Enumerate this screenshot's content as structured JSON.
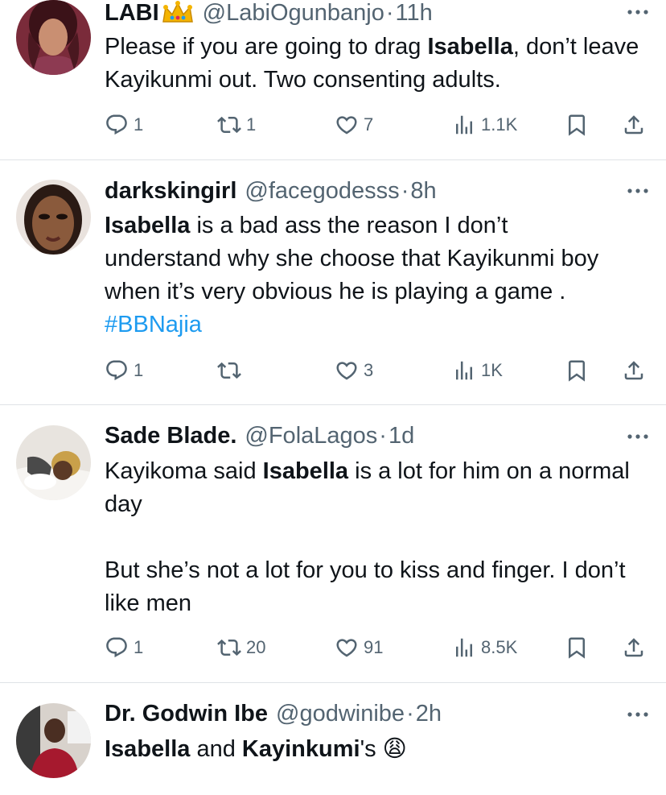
{
  "tweets": [
    {
      "name": "LABI",
      "handle": "@LabiOgunbanjo",
      "time": "11h",
      "body": [
        "Please if you are going to drag ",
        {
          "b": "Isabella"
        },
        ", don’t leave Kayikunmi out. Two consenting adults."
      ],
      "replies": "1",
      "retweets": "1",
      "likes": "7",
      "views": "1.1K"
    },
    {
      "name": "darkskingirl",
      "handle": "@facegodesss",
      "time": "8h",
      "body": [
        {
          "b": "Isabella"
        },
        " is a bad ass the reason I don’t understand why she choose that Kayikunmi boy when it’s very obvious he is playing a game . ",
        {
          "tag": "#BBNajia"
        }
      ],
      "replies": "1",
      "retweets": "",
      "likes": "3",
      "views": "1K"
    },
    {
      "name": "Sade Blade.",
      "handle": "@FolaLagos",
      "time": "1d",
      "body": [
        "Kayikoma said ",
        {
          "b": "Isabella"
        },
        " is a lot for him on a normal day",
        {
          "br": 2
        },
        "But she’s not a lot for you to kiss and finger. I don’t like men"
      ],
      "replies": "1",
      "retweets": "20",
      "likes": "91",
      "views": "8.5K"
    },
    {
      "name": "Dr. Godwin Ibe",
      "handle": "@godwinibe",
      "time": "2h",
      "body": [
        {
          "b": "Isabella"
        },
        " and ",
        {
          "b": "Kayinkumi"
        },
        "'s  😩"
      ],
      "replies": "",
      "retweets": "",
      "likes": "",
      "views": ""
    }
  ],
  "colors": {
    "text": "#0f1419",
    "secondary": "#536471",
    "link": "#1d9bf0",
    "divider": "#dfe3e6"
  },
  "icons": [
    "crown-emoji-icon",
    "more-icon",
    "reply-icon",
    "retweet-icon",
    "like-icon",
    "views-icon",
    "bookmark-icon",
    "share-icon"
  ]
}
